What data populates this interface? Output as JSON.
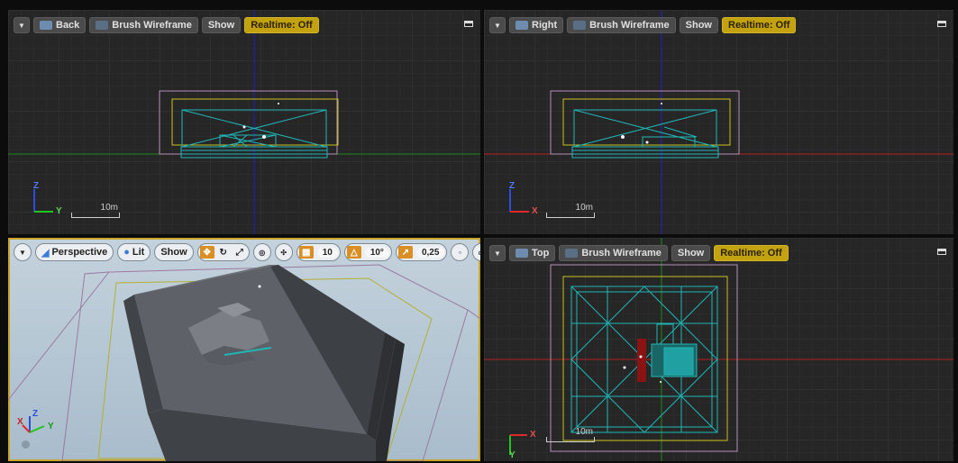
{
  "viewports": {
    "back": {
      "view_label": "Back",
      "mode_label": "Brush Wireframe",
      "show_label": "Show",
      "realtime_label": "Realtime: Off",
      "scale_label": "10m",
      "axis_h": "Y",
      "axis_v": "Z"
    },
    "right": {
      "view_label": "Right",
      "mode_label": "Brush Wireframe",
      "show_label": "Show",
      "realtime_label": "Realtime: Off",
      "scale_label": "10m",
      "axis_h": "X",
      "axis_v": "Z"
    },
    "perspective": {
      "view_label": "Perspective",
      "lit_label": "Lit",
      "show_label": "Show",
      "grid_snap_value": "10",
      "rotation_snap_value": "10°",
      "scale_snap_value": "0,25",
      "axis_x": "X",
      "axis_y": "Y",
      "axis_z": "Z"
    },
    "top": {
      "view_label": "Top",
      "mode_label": "Brush Wireframe",
      "show_label": "Show",
      "realtime_label": "Realtime: Off",
      "scale_label": "10m",
      "axis_h": "X",
      "axis_v": "Y"
    }
  },
  "colors": {
    "wire": "#20b6b6",
    "bounds_yellow": "#c8c020",
    "bounds_pink": "#b58fb5",
    "axis_red": "#b02020",
    "axis_green": "#1a8a1a",
    "axis_blue": "#2020c0",
    "realtime_badge": "#c3a20f",
    "active_outline": "#c9a62a"
  },
  "icons": {
    "menu": "chevron-down-icon",
    "maximize": "maximize-icon",
    "translate": "move-icon",
    "rotate": "rotate-icon",
    "scale": "scale-icon",
    "world": "globe-icon",
    "surface_snap": "surface-snap-icon",
    "grid": "grid-icon",
    "angle": "angle-icon",
    "camera_speed": "camera-speed-icon"
  }
}
